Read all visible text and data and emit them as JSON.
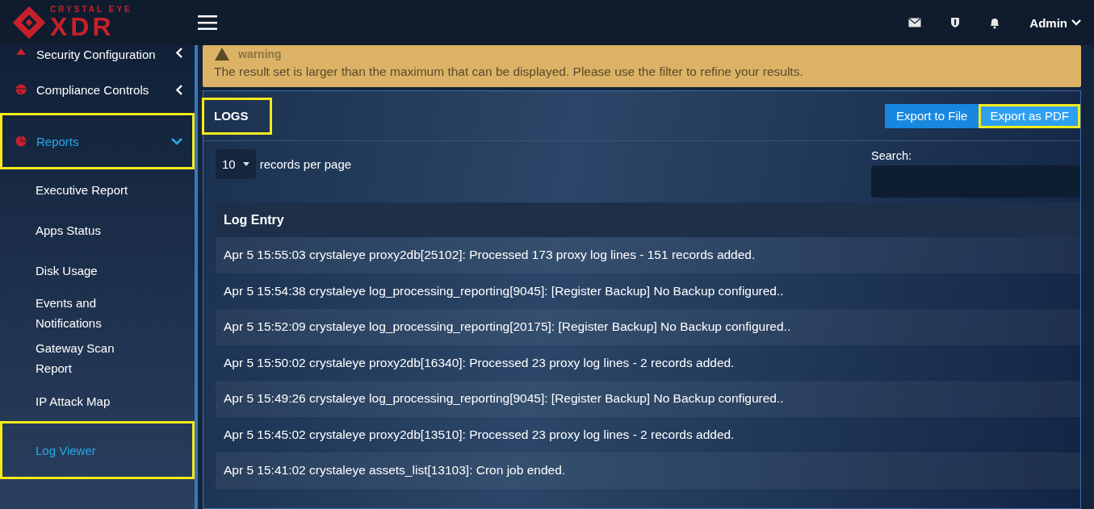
{
  "header": {
    "logo_small": "CRYSTAL EYE",
    "logo_large": "XDR",
    "user": "Admin"
  },
  "sidebar": {
    "items": [
      {
        "label": "Security Configuration",
        "expanded": false,
        "selected": false,
        "highlighted": false
      },
      {
        "label": "Compliance Controls",
        "expanded": false,
        "selected": false,
        "highlighted": false
      },
      {
        "label": "Reports",
        "expanded": true,
        "selected": true,
        "highlighted": true,
        "children": [
          {
            "label": "Executive Report",
            "selected": false,
            "highlighted": false
          },
          {
            "label": "Apps Status",
            "selected": false,
            "highlighted": false
          },
          {
            "label": "Disk Usage",
            "selected": false,
            "highlighted": false
          },
          {
            "label": "Events and Notifications",
            "selected": false,
            "highlighted": false
          },
          {
            "label": "Gateway Scan Report",
            "selected": false,
            "highlighted": false
          },
          {
            "label": "IP Attack Map",
            "selected": false,
            "highlighted": false
          },
          {
            "label": "Log Viewer",
            "selected": true,
            "highlighted": true
          }
        ]
      }
    ]
  },
  "warning": {
    "title": "warning",
    "message": "The result set is larger than the maximum that can be displayed. Please use the filter to refine your results."
  },
  "panel": {
    "title": "LOGS",
    "title_highlighted": true,
    "buttons": [
      {
        "label": "Export to File",
        "highlighted": false
      },
      {
        "label": "Export as PDF",
        "highlighted": true
      }
    ],
    "page_size": "10",
    "page_size_label": "records per page",
    "search_label": "Search:",
    "table": {
      "columns": [
        "Log Entry"
      ],
      "rows": [
        "Apr 5 15:55:03 crystaleye proxy2db[25102]: Processed 173 proxy log lines - 151 records added.",
        "Apr 5 15:54:38 crystaleye log_processing_reporting[9045]: [Register Backup] No Backup configured..",
        "Apr 5 15:52:09 crystaleye log_processing_reporting[20175]: [Register Backup] No Backup configured..",
        "Apr 5 15:50:02 crystaleye proxy2db[16340]: Processed 23 proxy log lines - 2 records added.",
        "Apr 5 15:49:26 crystaleye log_processing_reporting[9045]: [Register Backup] No Backup configured..",
        "Apr 5 15:45:02 crystaleye proxy2db[13510]: Processed 23 proxy log lines - 2 records added.",
        "Apr 5 15:41:02 crystaleye assets_list[13103]: Cron job ended."
      ]
    }
  }
}
